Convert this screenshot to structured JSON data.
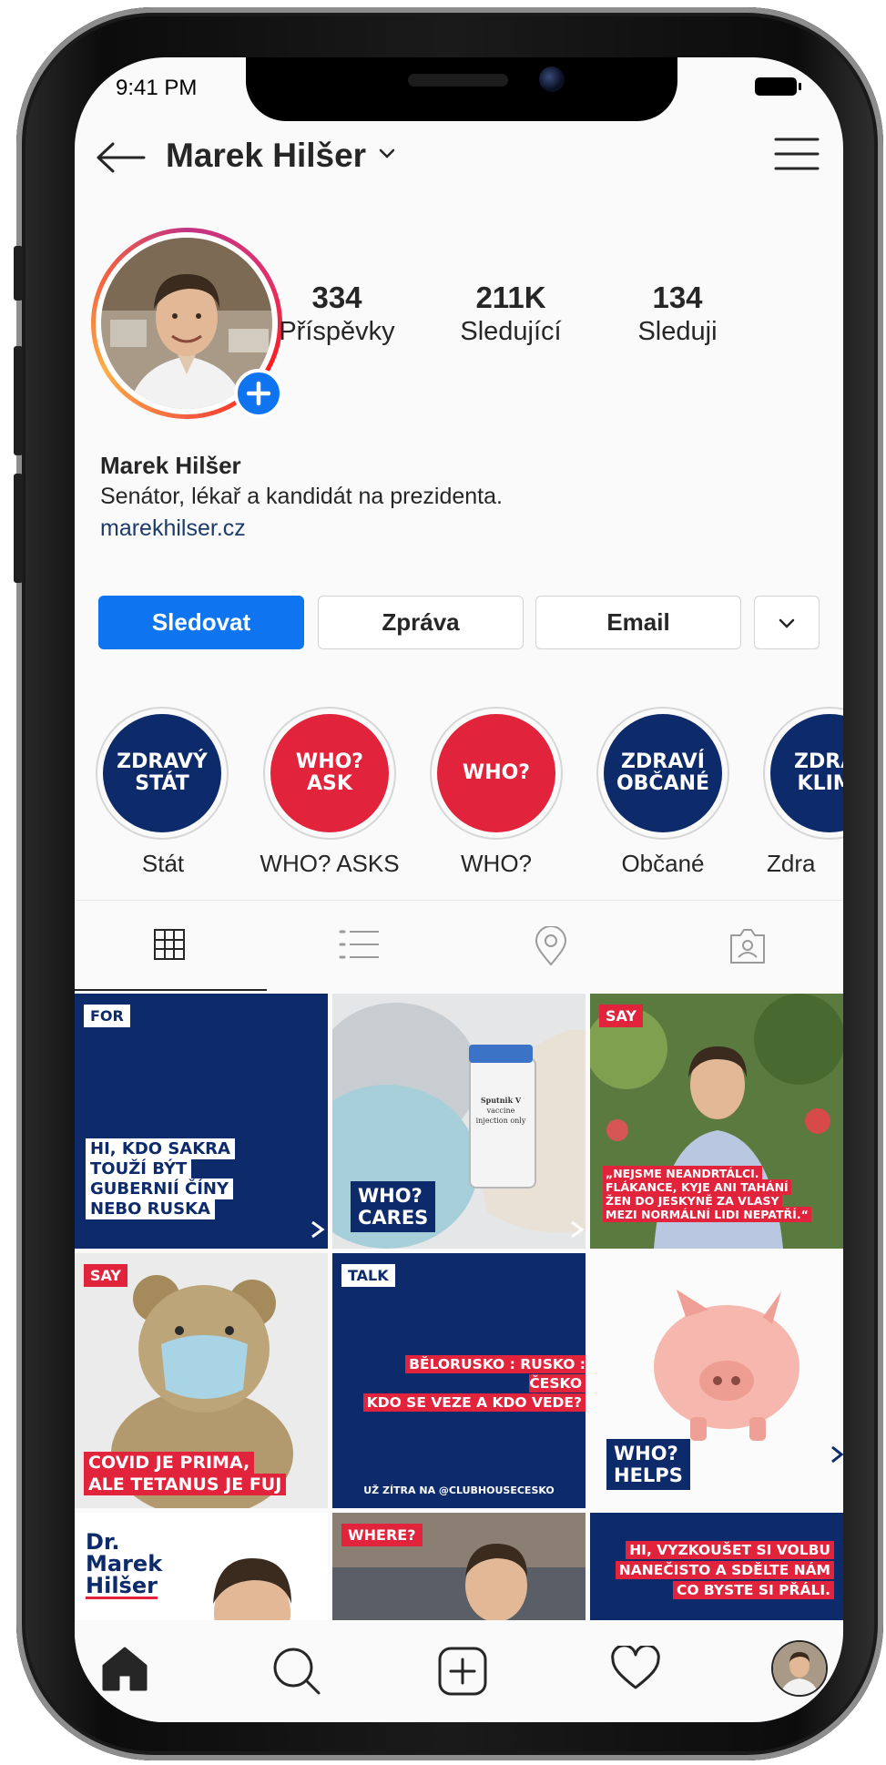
{
  "status": {
    "time": "9:41 PM"
  },
  "header": {
    "username": "Marek Hilšer"
  },
  "stats": [
    {
      "value": "334",
      "label": "Příspěvky"
    },
    {
      "value": "211K",
      "label": "Sledující"
    },
    {
      "value": "134",
      "label": "Sleduji"
    }
  ],
  "bio": {
    "name": "Marek Hilšer",
    "text": "Senátor, lékař a kandidát na prezidenta.",
    "link": "marekhilser.cz"
  },
  "buttons": {
    "follow": "Sledovat",
    "message": "Zpráva",
    "email": "Email"
  },
  "highlights": [
    {
      "line1": "ZDRAVÝ",
      "line2": "STÁT",
      "label": "Stát"
    },
    {
      "line1": "WHO?",
      "line2": "ASK",
      "label": "WHO? ASKS"
    },
    {
      "line1": "WHO?",
      "line2": "",
      "label": "WHO?"
    },
    {
      "line1": "ZDRAVÍ",
      "line2": "OBČANÉ",
      "label": "Občané"
    },
    {
      "line1": "ZDRA",
      "line2": "KLIM",
      "label": "Zdra"
    }
  ],
  "posts": {
    "p1": {
      "tag": "FOR",
      "caption": [
        "HI, KDO SAKRA",
        "TOUŽÍ BÝT",
        "GUBERNIÍ ČÍNY",
        "NEBO RUSKA"
      ]
    },
    "p2": {
      "caption": [
        "WHO?",
        "CARES"
      ],
      "vial": [
        "Sputnik V",
        "vaccine",
        "injection only"
      ]
    },
    "p3": {
      "tag": "SAY",
      "caption": [
        "„NEJSME NEANDRTÁLCI.",
        "FLÁKANCE, KYJE ANI TAHÁNÍ",
        "ŽEN DO JESKYNĚ ZA VLASY",
        "MEZI NORMÁLNÍ LIDI NEPATŘÍ.“"
      ]
    },
    "p4": {
      "tag": "SAY",
      "caption": [
        "COVID JE PRIMA,",
        "ALE TETANUS JE FUJ"
      ]
    },
    "p5": {
      "tag": "TALK",
      "caption": [
        "BĚLORUSKO : RUSKO : ČESKO",
        "KDO SE VEZE A KDO VEDE?"
      ],
      "footer": "UŽ ZÍTRA NA @CLUBHOUSECESKO"
    },
    "p6": {
      "caption": [
        "WHO?",
        "HELPS"
      ]
    },
    "p7": {
      "logo": [
        "Dr.",
        "Marek",
        "Hilšer"
      ]
    },
    "p8": {
      "tag": "WHERE?"
    },
    "p9": {
      "caption": [
        "HI, VYZKOUŠET SI VOLBU",
        "NANEČISTO A SDĚLTE NÁM",
        "CO BYSTE SI PŘÁLI."
      ]
    }
  },
  "colors": {
    "blue": "#0f74f0",
    "navy": "#0d2a6b",
    "red": "#e1233c"
  }
}
